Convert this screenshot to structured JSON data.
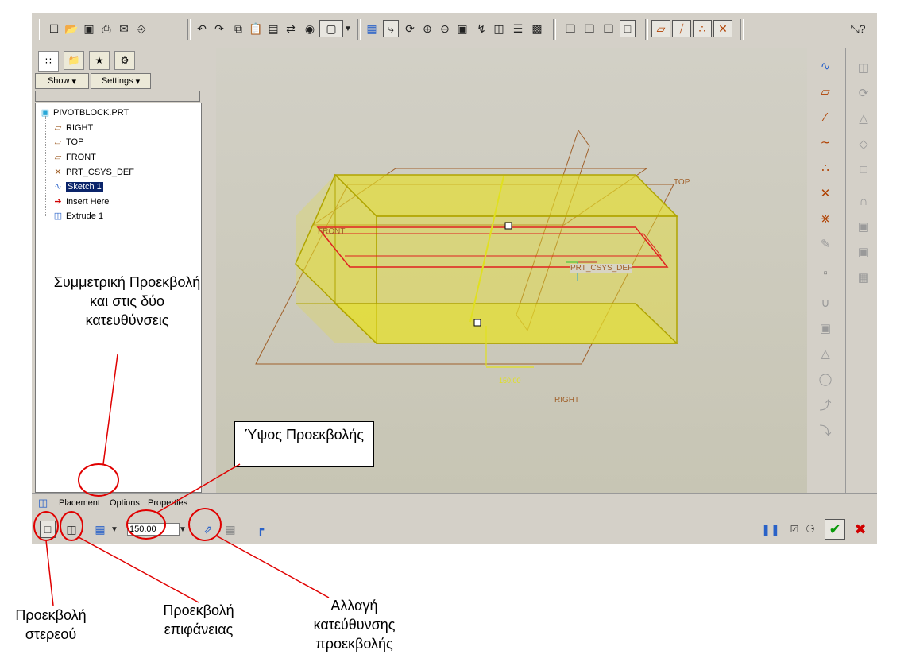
{
  "toolbar": {
    "groups": [
      [
        "new-icon",
        "open-icon",
        "save-icon",
        "print-icon",
        "send-icon",
        "email-icon"
      ],
      [
        "undo-icon",
        "redo-icon",
        "copy-icon",
        "paste-icon",
        "paste-special-icon",
        "regenerate-icon",
        "find-icon",
        "select-box-icon"
      ],
      [
        "repaint-icon",
        "spin-center-icon",
        "orient-icon",
        "zoom-in-icon",
        "zoom-out-icon",
        "refit-icon",
        "reorient-icon",
        "saved-views-icon",
        "layers-icon",
        "model-display-icon"
      ],
      [
        "wireframe-icon",
        "hidden-line-icon",
        "no-hidden-icon",
        "shading-icon"
      ],
      [
        "datum-planes-icon",
        "datum-axes-icon",
        "datum-points-icon",
        "csys-icon"
      ],
      [
        "whats-this-icon"
      ]
    ],
    "active": [
      "spin-center-icon",
      "shading-icon",
      "datum-planes-icon",
      "datum-axes-icon",
      "datum-points-icon",
      "csys-icon"
    ]
  },
  "navigator": {
    "tabs": [
      "model-tree-tab",
      "folder-browser-tab",
      "favorites-tab",
      "connections-tab"
    ],
    "show_label": "Show",
    "settings_label": "Settings",
    "items": [
      {
        "label": "PIVOTBLOCK.PRT",
        "icon": "part-icon",
        "indent": 0
      },
      {
        "label": "RIGHT",
        "icon": "datum-plane-icon",
        "indent": 1
      },
      {
        "label": "TOP",
        "icon": "datum-plane-icon",
        "indent": 1
      },
      {
        "label": "FRONT",
        "icon": "datum-plane-icon",
        "indent": 1
      },
      {
        "label": "PRT_CSYS_DEF",
        "icon": "csys-icon",
        "indent": 1
      },
      {
        "label": "Sketch 1",
        "icon": "sketch-icon",
        "indent": 1,
        "selected": true
      },
      {
        "label": "Insert Here",
        "icon": "insert-arrow-icon",
        "indent": 1
      },
      {
        "label": "Extrude 1",
        "icon": "extrude-icon",
        "indent": 1
      }
    ]
  },
  "viewport": {
    "labels": {
      "front": "FRONT",
      "top": "TOP",
      "right": "RIGHT",
      "csys": "PRT_CSYS_DEF",
      "depth": "150.00"
    }
  },
  "dashboard": {
    "tabs": [
      "Placement",
      "Options",
      "Properties"
    ],
    "depth_value": "150.00",
    "show_preview": true
  },
  "annotations": {
    "symmetric": "Συμμετρική Προεκβολή και στις δύο κατευθύνσεις",
    "height": "Ύψος Προεκβολής",
    "solid": "Προεκβολή στερεού",
    "surface": "Προεκβολή επιφάνειας",
    "flip": "Αλλαγή κατεύθυνσης προεκβολής"
  },
  "colors": {
    "solid_fill": "#e6e02a",
    "edge": "#b0a400",
    "sketch": "#e02020",
    "datum": "#a0602a",
    "callout": "#e00000",
    "confirm": "#0a9a0a",
    "cancel": "#d00000"
  }
}
